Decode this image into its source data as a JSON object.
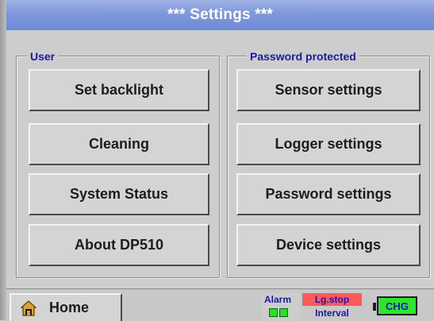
{
  "title": "***  Settings  ***",
  "groups": {
    "user": {
      "legend": "User",
      "buttons": [
        "Set backlight",
        "Cleaning",
        "System Status",
        "About DP510"
      ]
    },
    "password": {
      "legend": "Password protected",
      "buttons": [
        "Sensor settings",
        "Logger settings",
        "Password settings",
        "Device settings"
      ]
    }
  },
  "statusbar": {
    "home_label": "Home",
    "home_icon": "house-icon",
    "alarm_label": "Alarm",
    "logger_status": "Lg.stop",
    "logger_interval": "Interval",
    "battery_label": "CHG"
  },
  "colors": {
    "titlebar": "#7f98dc",
    "legend_text": "#1a1aa6",
    "alarm_led": "#29e029",
    "logger_stop_bg": "#ff5a5a",
    "battery_fill": "#2ee52e"
  }
}
